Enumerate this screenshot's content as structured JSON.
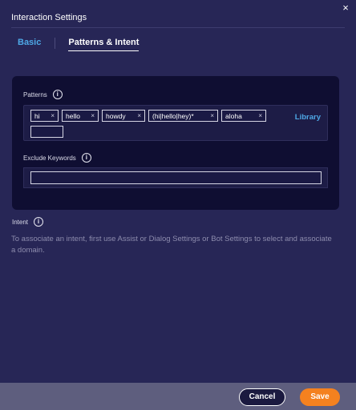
{
  "dialog": {
    "title": "Interaction Settings",
    "close_glyph": "×"
  },
  "tabs": [
    {
      "label": "Basic",
      "active": false
    },
    {
      "label": "Patterns & Intent",
      "active": true
    }
  ],
  "patterns": {
    "label": "Patterns",
    "info_glyph": "i",
    "chips": [
      {
        "text": "hi",
        "remove": "×"
      },
      {
        "text": "hello",
        "remove": "×"
      },
      {
        "text": "howdy",
        "remove": "×"
      },
      {
        "text": "(hi|hello|hey)*",
        "remove": "×"
      },
      {
        "text": "aloha",
        "remove": "×"
      }
    ],
    "new_value": "",
    "library_label": "Library"
  },
  "exclude": {
    "label": "Exclude Keywords",
    "info_glyph": "i",
    "value": ""
  },
  "intent": {
    "label": "Intent",
    "info_glyph": "i",
    "help_text": "To associate an intent, first use Assist or Dialog Settings or Bot Settings to select and associate a domain."
  },
  "footer": {
    "cancel_label": "Cancel",
    "save_label": "Save"
  },
  "colors": {
    "background": "#272656",
    "panel": "#0f0e32",
    "accent_link": "#4ea8e6",
    "save_button": "#f4811f",
    "footer": "#5e5e7e"
  },
  "icons": {
    "close": "close-icon",
    "info": "info-icon",
    "chip_remove": "close-icon"
  }
}
